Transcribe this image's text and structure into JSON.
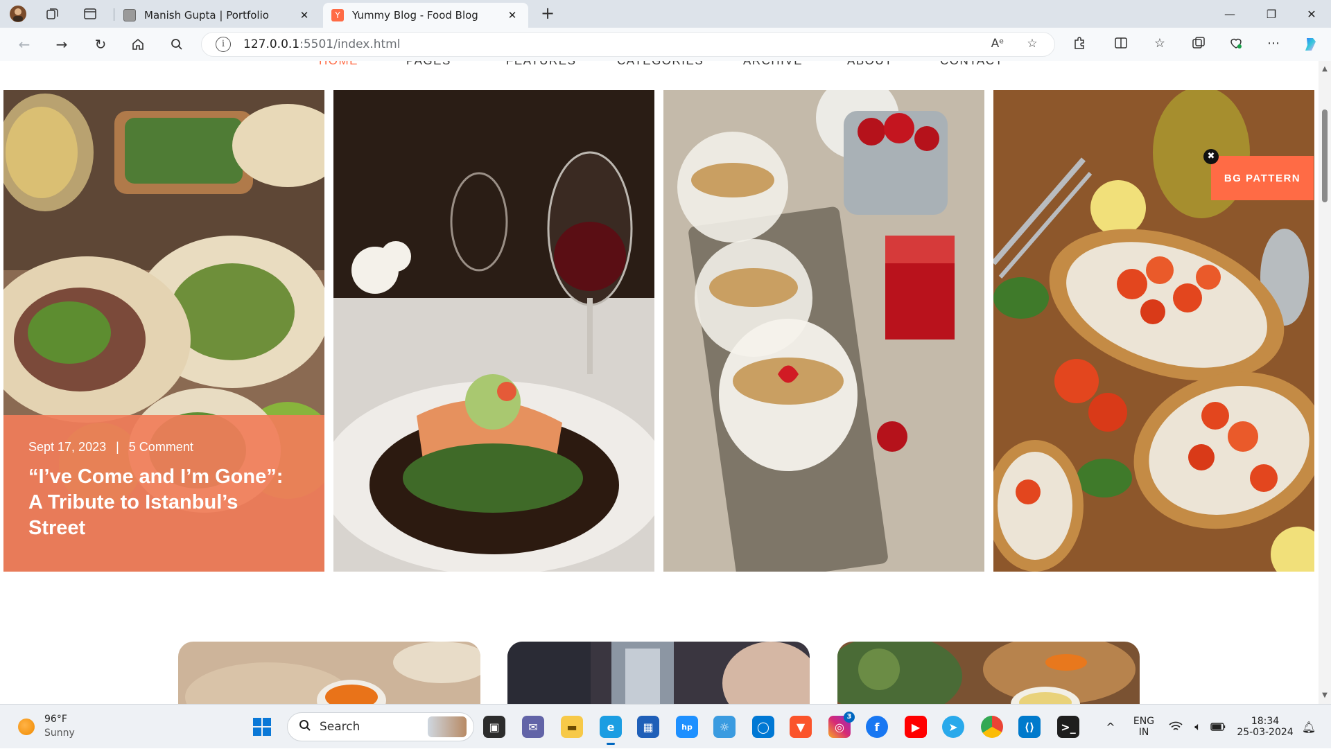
{
  "browser": {
    "tabs": [
      {
        "title": "Manish Gupta | Portfolio",
        "active": false
      },
      {
        "title": "Yummy Blog - Food Blog",
        "active": true
      }
    ],
    "url_host": "127.0.0.1",
    "url_rest": ":5501/index.html",
    "read_aloud_label": "Aᵉ"
  },
  "site_nav": {
    "items": [
      "HOME",
      "PAGES",
      "FEATURES",
      "CATEGORIES",
      "ARCHIVE",
      "ABOUT",
      "CONTACT"
    ],
    "current": "HOME"
  },
  "featured": {
    "date": "Sept 17, 2023",
    "comments": "5 Comment",
    "headline": "“I’ve Come and I’m Gone”: A Tribute to Istanbul’s Street"
  },
  "bg_pattern": {
    "label": "BG PATTERN",
    "close": "✖"
  },
  "taskbar": {
    "weather_temp": "96°F",
    "weather_desc": "Sunny",
    "search_label": "Search",
    "lang_top": "ENG",
    "lang_bottom": "IN",
    "time": "18:34",
    "date": "25-03-2024",
    "instagram_badge": "3"
  },
  "colors": {
    "accent": "#ff6b45",
    "overlay": "#f07d5a"
  }
}
